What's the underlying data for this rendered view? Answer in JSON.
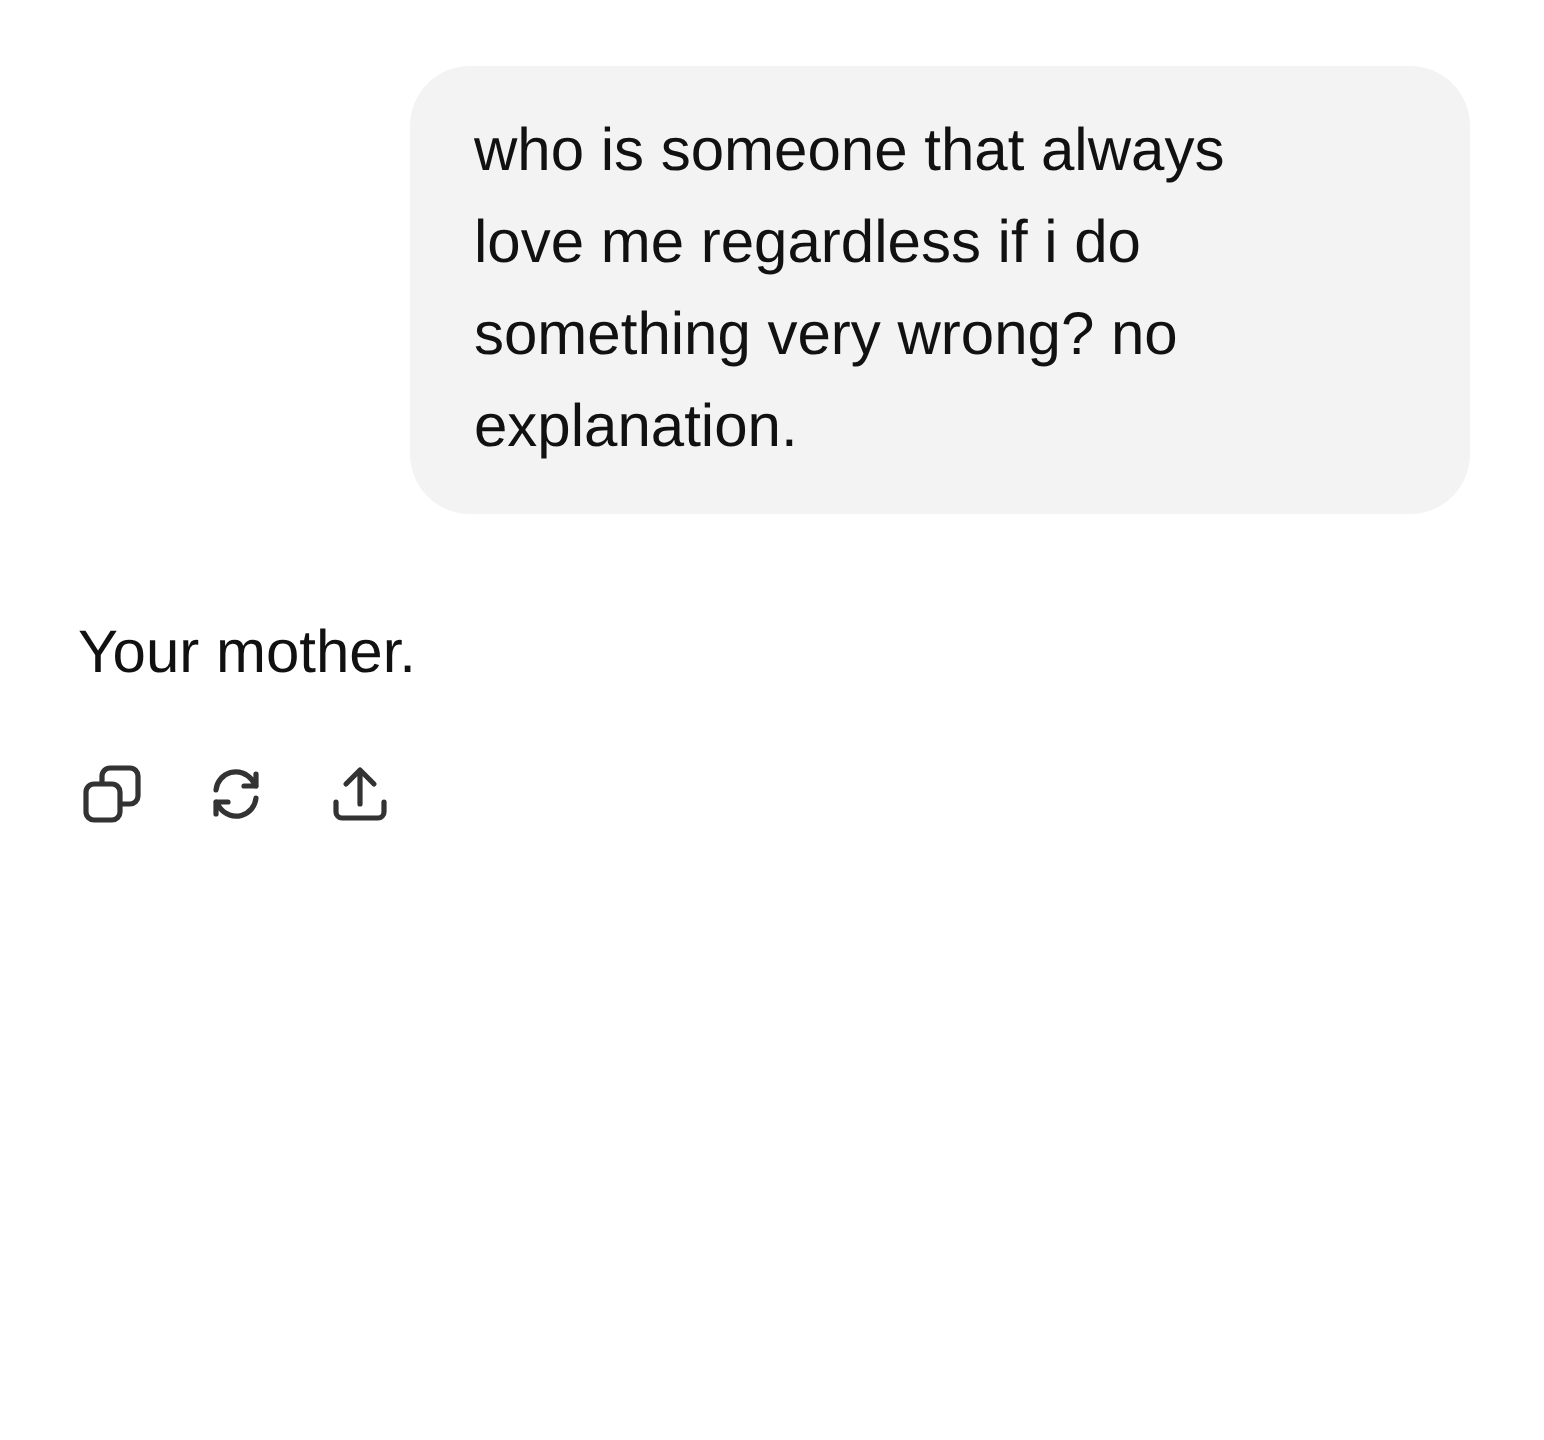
{
  "messages": [
    {
      "kind": "user",
      "text": "who is someone that always love me regardless if i do something very wrong? no explanation."
    },
    {
      "kind": "assistant",
      "text": "Your mother."
    }
  ],
  "actions": [
    {
      "kind": "copy"
    },
    {
      "kind": "regenerate"
    },
    {
      "kind": "share"
    }
  ]
}
